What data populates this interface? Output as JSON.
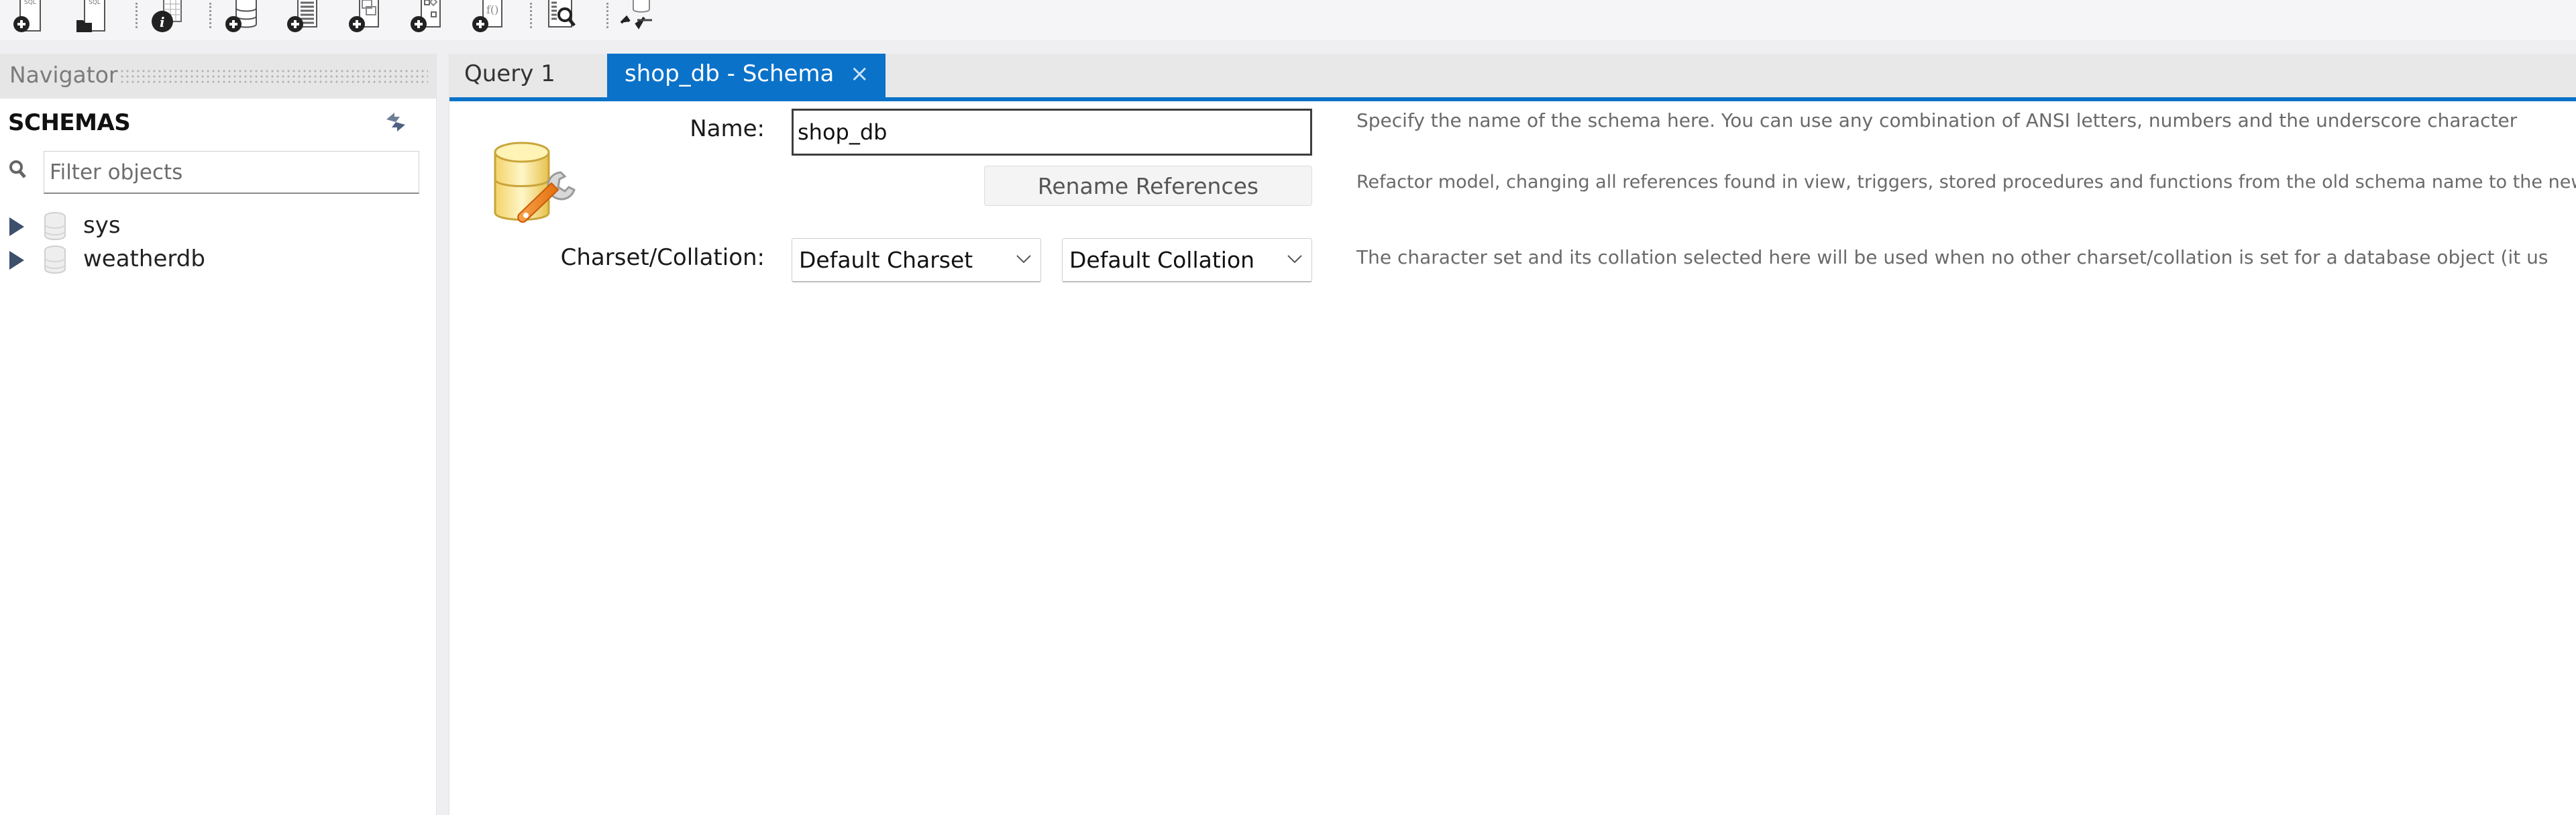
{
  "toolbar": {
    "buttons": [
      {
        "name": "new-sql-tab-icon"
      },
      {
        "name": "open-sql-script-icon"
      },
      {
        "name": "object-info-icon"
      },
      {
        "name": "create-schema-icon"
      },
      {
        "name": "create-table-icon"
      },
      {
        "name": "create-view-icon"
      },
      {
        "name": "create-procedure-icon"
      },
      {
        "name": "create-function-icon"
      },
      {
        "name": "search-table-data-icon"
      },
      {
        "name": "reconnect-icon"
      }
    ]
  },
  "navigator": {
    "title": "Navigator",
    "section_title": "SCHEMAS",
    "filter": {
      "placeholder": "Filter objects",
      "value": ""
    },
    "schemas": [
      {
        "label": "sys"
      },
      {
        "label": "weatherdb"
      }
    ]
  },
  "tabs": [
    {
      "label": "Query 1",
      "active": false
    },
    {
      "label": "shop_db - Schema",
      "active": true,
      "close": "×"
    }
  ],
  "schema_editor": {
    "name_label": "Name:",
    "name_value": "shop_db",
    "rename_button": "Rename References",
    "charset_label": "Charset/Collation:",
    "charset_value": "Default Charset",
    "collation_value": "Default Collation",
    "desc_name": "Specify the name of the schema here. You can use any combination of ANSI letters, numbers and the underscore character",
    "desc_rename": "Refactor model, changing all references found in view, triggers, stored procedures and functions from the old schema name to the new",
    "desc_charset": "The character set and its collation selected here will be used when no other charset/collation is set for a database object (it us"
  },
  "colors": {
    "accent": "#0a72c9",
    "tree_arrow": "#3c4f6b"
  }
}
